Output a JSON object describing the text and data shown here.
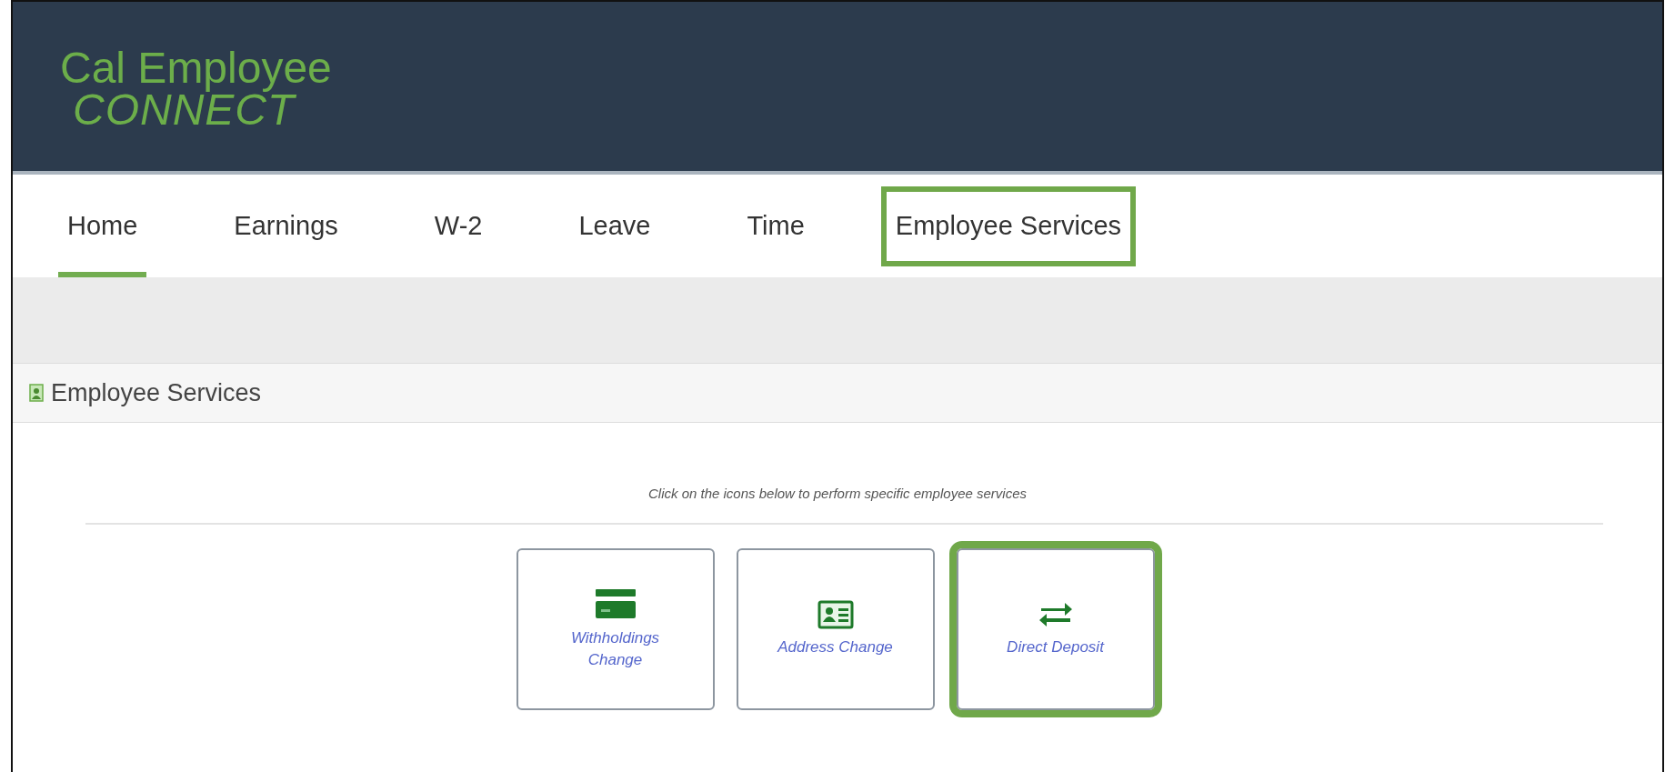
{
  "logo": {
    "line_1": "Cal Employee",
    "line_2": "CONNECT"
  },
  "tabs": [
    {
      "label": "Home",
      "selected": true,
      "highlighted": false
    },
    {
      "label": "Earnings",
      "selected": false,
      "highlighted": false
    },
    {
      "label": "W-2",
      "selected": false,
      "highlighted": false
    },
    {
      "label": "Leave",
      "selected": false,
      "highlighted": false
    },
    {
      "label": "Time",
      "selected": false,
      "highlighted": false
    },
    {
      "label": "Employee Services",
      "selected": false,
      "highlighted": true
    }
  ],
  "panel": {
    "title": "Employee Services",
    "instruction": "Click on the icons below to perform specific employee services",
    "tiles": [
      {
        "kind": "card",
        "label": "Withholdings Change",
        "highlighted": false
      },
      {
        "kind": "id-card",
        "label": "Address Change",
        "highlighted": false
      },
      {
        "kind": "transfer",
        "label": "Direct Deposit",
        "highlighted": true
      }
    ]
  }
}
